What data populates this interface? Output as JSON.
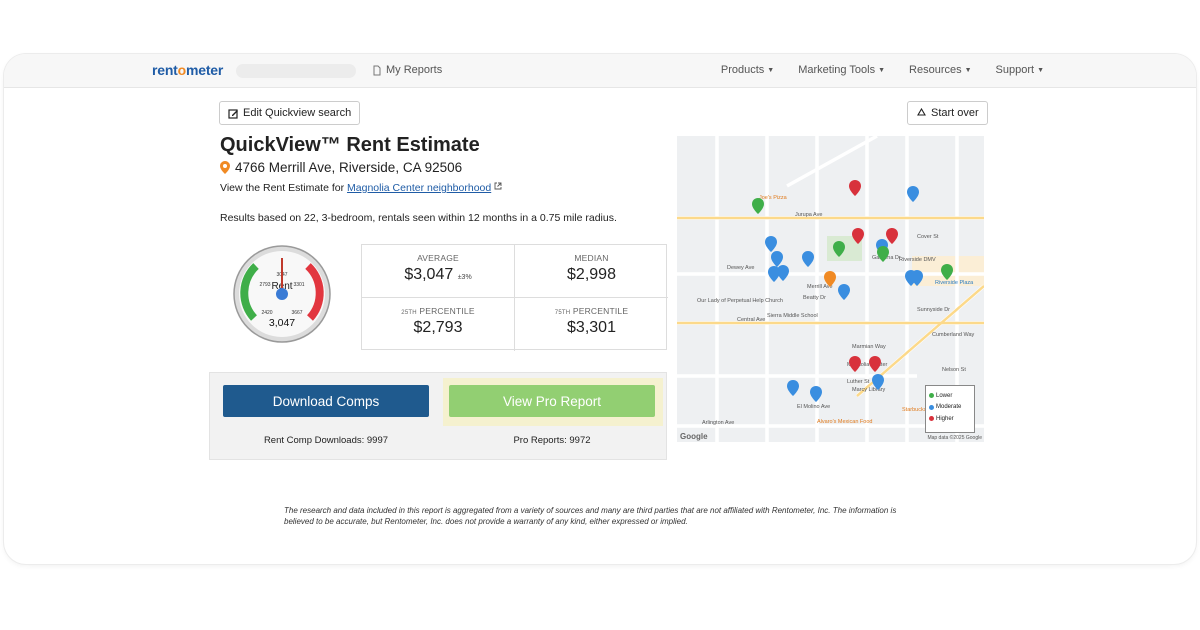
{
  "navbar": {
    "logo_prefix": "rent",
    "logo_o": "o",
    "logo_suffix": "meter",
    "my_reports": "My Reports",
    "menu": [
      "Products",
      "Marketing Tools",
      "Resources",
      "Support"
    ]
  },
  "toolbar": {
    "edit_label": "Edit Quickview search",
    "start_over_label": "Start over"
  },
  "report": {
    "title": "QuickView™ Rent Estimate",
    "address": "4766 Merrill Ave, Riverside, CA 92506",
    "neighborhood_prefix": "View the Rent Estimate for ",
    "neighborhood_link": "Magnolia Center neighborhood",
    "results_summary": "Results based on 22, 3-bedroom, rentals seen within 12 months in a 0.75 mile radius."
  },
  "gauge": {
    "label": "Rent",
    "value": "3,047",
    "ticks": [
      "2420",
      "2793",
      "3047",
      "3301",
      "3667"
    ],
    "colors": {
      "low": "#3fae49",
      "high": "#e2363f",
      "needle": "#c0392b",
      "hub": "#3a7bd5"
    }
  },
  "stats": {
    "average_label": "AVERAGE",
    "average_value": "$3,047",
    "average_margin": "±3%",
    "median_label": "MEDIAN",
    "median_value": "$2,998",
    "p25_label_sup": "25TH",
    "p25_label": " PERCENTILE",
    "p25_value": "$2,793",
    "p75_label_sup": "75TH",
    "p75_label": " PERCENTILE",
    "p75_value": "$3,301"
  },
  "actions": {
    "download_label": "Download Comps",
    "pro_label": "View Pro Report",
    "download_count": "Rent Comp Downloads: 9997",
    "pro_count": "Pro Reports: 9972"
  },
  "map": {
    "streets": [
      "Jurupa Ave",
      "Riverside DMV",
      "Dewey Ave",
      "Merrill Ave",
      "Beatty Dr",
      "Central Ave",
      "Sierra Middle School",
      "Our Lady of Perpetual Help Church",
      "Magnolia Center",
      "Marcy Library",
      "Starbucks",
      "Arlington Ave",
      "Alvaro's Mexican Food",
      "Joe's Pizza",
      "Riverside Plaza",
      "Sunnyside Dr",
      "Cover St",
      "Gardena Dr",
      "Luther St",
      "El Molino Ave",
      "Nelson St",
      "Marmian Way",
      "Cumberland Way"
    ],
    "legend": [
      "Lower",
      "Moderate",
      "Higher"
    ],
    "legend_colors": [
      "#3fae49",
      "#3a8ee0",
      "#d8323c"
    ],
    "credit": "Map data ©2025 Google",
    "google": "Google"
  },
  "disclaimer": "The research and data included in this report is aggregated from a variety of sources and many are third parties that are not affiliated with Rentometer, Inc. The information is believed to be accurate, but Rentometer, Inc. does not provide a warranty of any kind, either expressed or implied."
}
